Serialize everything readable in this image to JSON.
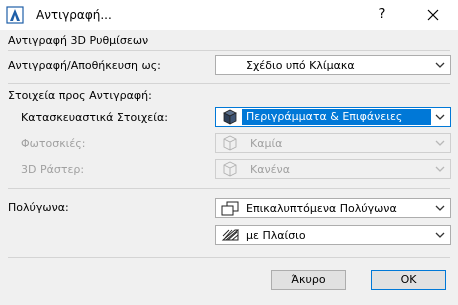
{
  "window": {
    "title": "Αντιγραφή...",
    "help_label": "?"
  },
  "section_3d": {
    "label": "Αντιγραφή 3D Ρυθμίσεων"
  },
  "copy_as": {
    "label": "Αντιγραφή/Αποθήκευση ως:",
    "value": "Σχέδιο υπό Κλίμακα"
  },
  "elements": {
    "label": "Στοιχεία προς Αντιγραφή:",
    "construction": {
      "label": "Κατασκευαστικά Στοιχεία:",
      "value": "Περιγράμματα & Επιφάνειες",
      "icon": "cube-icon"
    },
    "shadows": {
      "label": "Φωτοσκιές:",
      "value": "Καμία",
      "icon": "cube-outline-icon"
    },
    "raster": {
      "label": "3D Ράστερ:",
      "value": "Κανένα",
      "icon": "cube-outline-icon"
    }
  },
  "polygons": {
    "label": "Πολύγωνα:",
    "type": {
      "value": "Επικαλυπτόμενα Πολύγωνα",
      "icon": "overlapping-polygons-icon"
    },
    "frame": {
      "value": "με Πλαίσιο",
      "icon": "hatched-frame-icon"
    }
  },
  "buttons": {
    "cancel": "Άκυρο",
    "ok": "OK"
  },
  "colors": {
    "accent": "#0078d7",
    "background": "#f0f0f0",
    "disabled_text": "#a0a0a0"
  }
}
